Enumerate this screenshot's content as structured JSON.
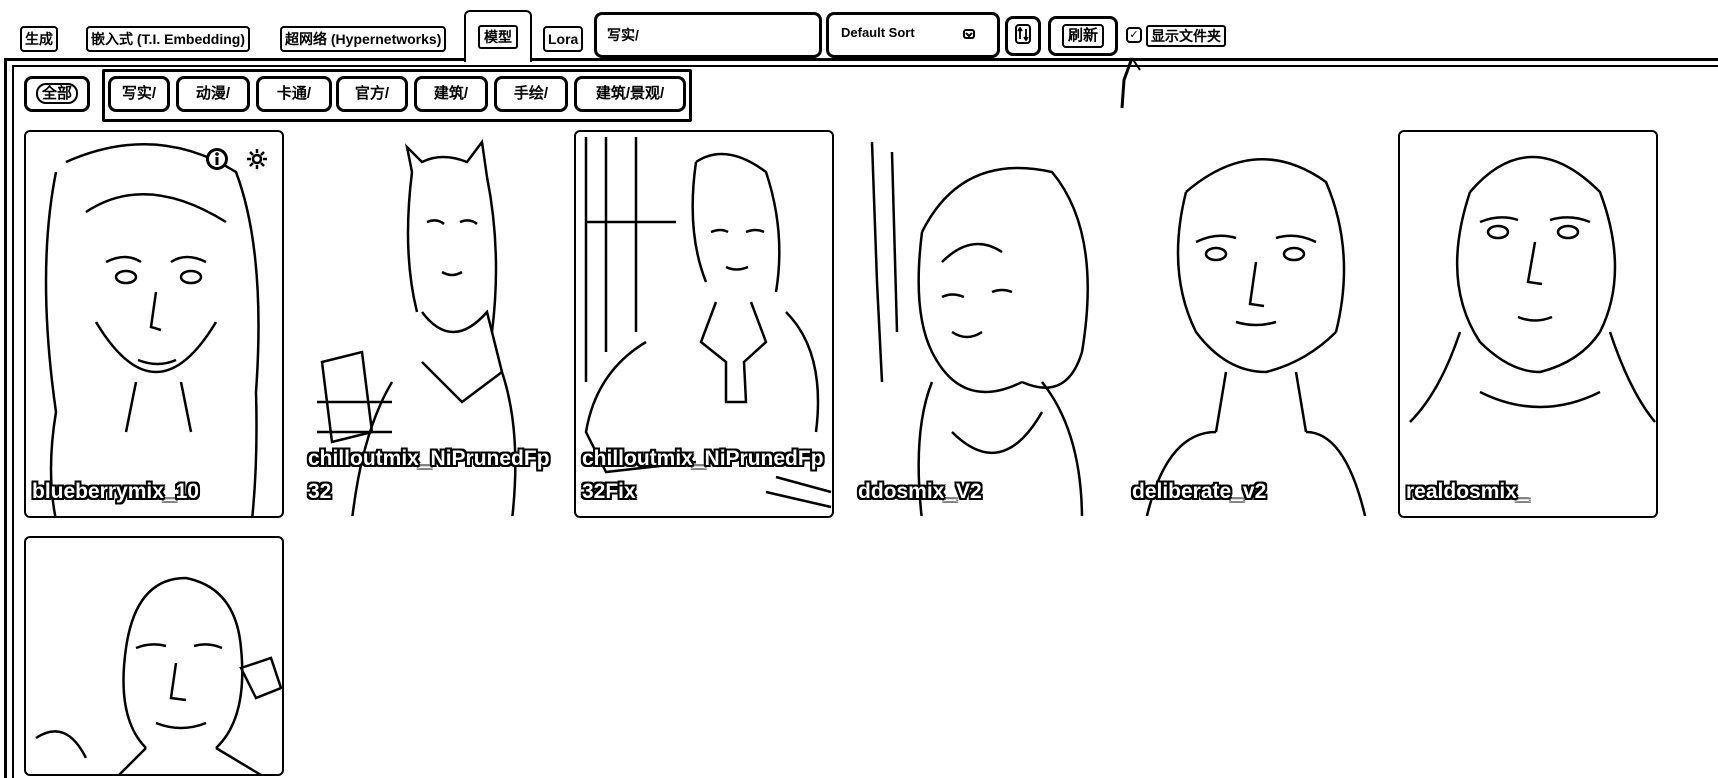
{
  "tabs": [
    {
      "label": "生成"
    },
    {
      "label": "嵌入式 (T.I. Embedding)"
    },
    {
      "label": "超网络 (Hypernetworks)"
    },
    {
      "label": "模型"
    },
    {
      "label": "Lora"
    }
  ],
  "search": {
    "value": "写实/"
  },
  "sort": {
    "label": "Default Sort",
    "icon": "chevron-down-icon"
  },
  "toolbar": {
    "sort_direction_icon": "sort-direction-icon",
    "refresh_label": "刷新",
    "show_folders_label": "显示文件夹",
    "show_folders_checked": true
  },
  "filters": {
    "all_label": "全部",
    "items": [
      "写实/",
      "动漫/",
      "卡通/",
      "官方/",
      "建筑/",
      "手绘/",
      "建筑/景观/"
    ]
  },
  "cards": [
    {
      "title": "blueberrymix_10"
    },
    {
      "title": "chilloutmix_NiPrunedFp32"
    },
    {
      "title": "chilloutmix_NiPrunedFp32Fix"
    },
    {
      "title": "ddosmix_V2"
    },
    {
      "title": "deliberate_v2"
    },
    {
      "title": "realdosmix_"
    },
    {
      "title": ""
    }
  ],
  "colors": {
    "ink": "#000000",
    "paper": "#ffffff"
  }
}
